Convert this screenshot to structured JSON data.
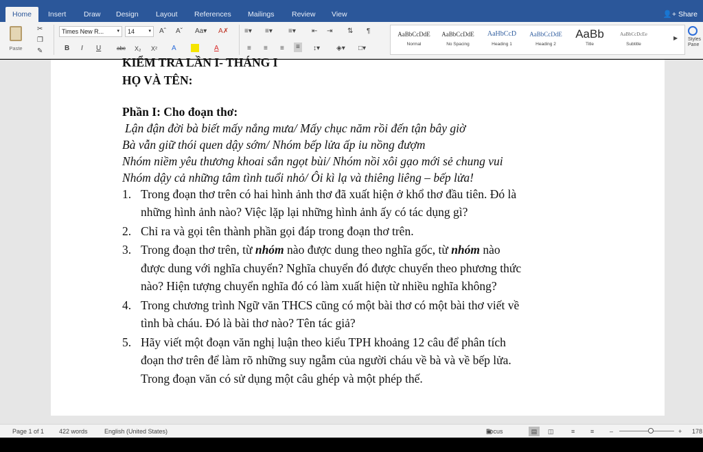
{
  "tabs": [
    {
      "label": "Home"
    },
    {
      "label": "Insert"
    },
    {
      "label": "Draw"
    },
    {
      "label": "Design"
    },
    {
      "label": "Layout"
    },
    {
      "label": "References"
    },
    {
      "label": "Mailings"
    },
    {
      "label": "Review"
    },
    {
      "label": "View"
    }
  ],
  "share_label": "Share",
  "ribbon": {
    "paste_label": "Paste",
    "font_name": "Times New R...",
    "font_size": "14",
    "styles": [
      {
        "sample": "AaBbCcDdE",
        "name": "Normal"
      },
      {
        "sample": "AaBbCcDdE",
        "name": "No Spacing"
      },
      {
        "sample": "AaHbCcD",
        "name": "Heading 1"
      },
      {
        "sample": "AaBbCcDdE",
        "name": "Heading 2"
      },
      {
        "sample": "AaBb",
        "name": "Title"
      },
      {
        "sample": "AaBbCcDcEe",
        "name": "Subtitle"
      }
    ],
    "styles_pane": "Styles Pane"
  },
  "document": {
    "title_line": "KIỂM TRA LẦN I- THÁNG I",
    "name_line": "HỌ VÀ TÊN:",
    "part_heading": "Phần I: Cho đoạn thơ:",
    "poem": [
      "Lận đận đời bà biết mấy nắng mưa/ Mấy chục năm rồi đến tận bây giờ",
      "Bà vẫn giữ thói quen dậy sớm/ Nhóm bếp lửa ấp iu nồng đượm",
      "Nhóm niềm yêu thương khoai sắn ngọt bùi/ Nhóm nồi xôi gạo mới sẻ chung vui",
      "Nhóm dậy cả những tâm tình tuổi nhỏ/ Ôi kì lạ và thiêng liêng – bếp lửa!"
    ],
    "q1": {
      "num": "1.",
      "lines": [
        "Trong đoạn thơ trên có hai hình ảnh thơ đã xuất hiện ở khổ thơ đầu tiên. Đó là",
        "những hình ảnh nào? Việc lặp lại những hình ảnh ấy có tác dụng gì?"
      ]
    },
    "q2": {
      "num": "2.",
      "lines": [
        "Chỉ ra và gọi tên thành phần gọi đáp trong đoạn thơ trên."
      ]
    },
    "q3": {
      "num": "3.",
      "a": "Trong đoạn thơ trên, từ ",
      "w1": "nhóm",
      "b": " nào được dung theo nghĩa gốc, từ ",
      "w2": "nhóm",
      "c": " nào",
      "lines": [
        "được dung với nghĩa chuyển? Nghĩa chuyển đó được chuyển theo phương thức",
        "nào? Hiện tượng chuyển nghĩa đó có làm xuất hiện từ nhiều nghĩa không?"
      ]
    },
    "q4": {
      "num": "4.",
      "lines": [
        "Trong chương trình Ngữ văn THCS cũng có một bài thơ có một bài thơ viết về",
        "tình bà cháu. Đó là bài thơ nào? Tên tác giả?"
      ]
    },
    "q5": {
      "num": "5.",
      "lines": [
        "Hãy viết một đoạn văn nghị luận theo kiểu TPH khoảng 12 câu để phân tích",
        "đoạn thơ trên để làm rõ những suy ngẫm của người cháu về bà và về bếp lửa.",
        "Trong đoạn văn có sử dụng một câu ghép và một phép thế."
      ]
    }
  },
  "status": {
    "page": "Page 1 of 1",
    "words": "422 words",
    "language": "English (United States)",
    "focus": "Focus",
    "zoom": "178"
  }
}
